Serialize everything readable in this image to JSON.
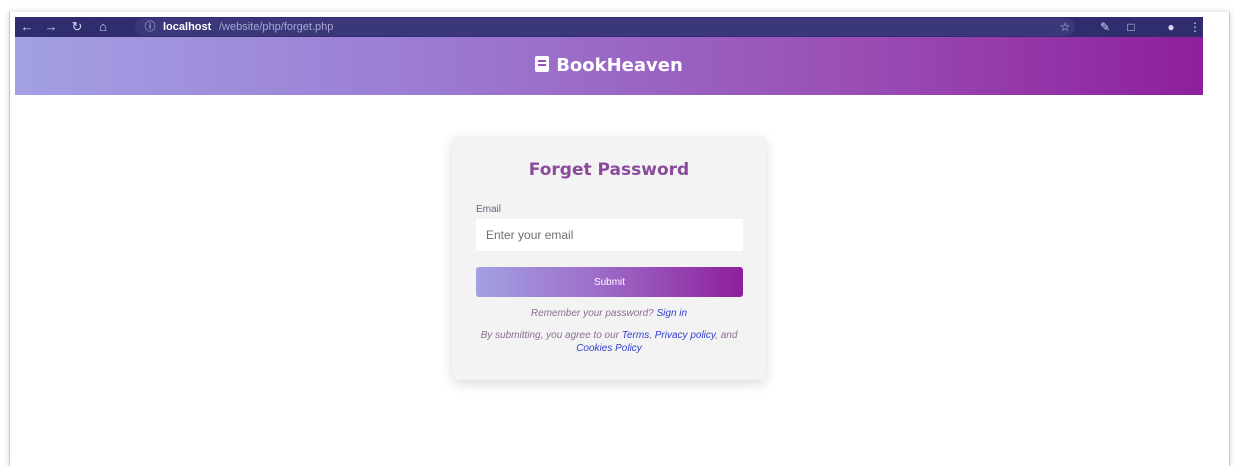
{
  "browser": {
    "back_icon": "arrow-left-icon",
    "forward_icon": "arrow-right-icon",
    "reload_icon": "reload-icon",
    "home_icon": "home-icon",
    "url_host": "localhost",
    "url_path": "/website/php/forget.php",
    "bookmark_icon": "star-icon",
    "edit_icon": "pencil-icon",
    "extension_icon": "extension-icon",
    "menu_icon": "kebab-menu-icon"
  },
  "header": {
    "brand_name": "BookHeaven",
    "brand_icon": "book-icon",
    "gradient_start": "#a3a0e4",
    "gradient_end": "#8e1f9c"
  },
  "form": {
    "title": "Forget Password",
    "email_label": "Email",
    "email_placeholder": "Enter your email",
    "email_value": "",
    "submit_label": "Submit",
    "remember_text": "Remember your password?",
    "sign_in_link": "Sign in",
    "legal_prefix": "By submitting, you agree to our",
    "terms_link": "Terms",
    "separator": ",",
    "privacy_link": "Privacy policy",
    "and_text": ", and",
    "cookies_link": "Cookies Policy",
    "title_color": "#8a4a9b",
    "link_color": "#2f3fd0"
  }
}
